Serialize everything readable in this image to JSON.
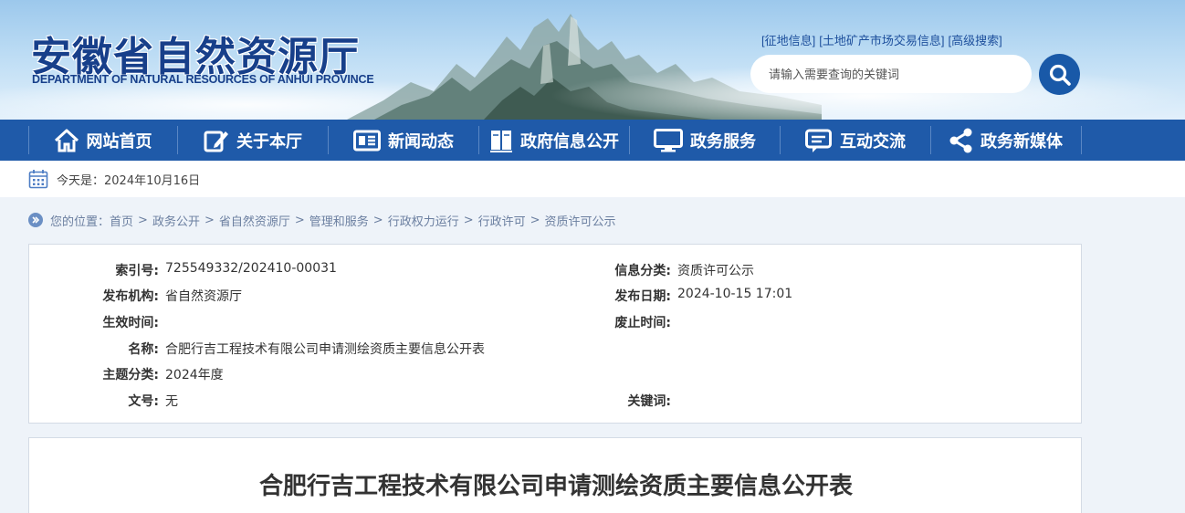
{
  "header": {
    "logo_cn": "安徽省自然资源厅",
    "logo_en": "DEPARTMENT OF NATURAL RESOURCES OF ANHUI PROVINCE",
    "top_links": [
      "[征地信息]",
      "[土地矿产市场交易信息]",
      "[高级搜索]"
    ],
    "search_placeholder": "请输入需要查询的关键词"
  },
  "nav": {
    "items": [
      {
        "label": "网站首页",
        "icon": "home-icon"
      },
      {
        "label": "关于本厅",
        "icon": "edit-icon"
      },
      {
        "label": "新闻动态",
        "icon": "news-icon"
      },
      {
        "label": "政府信息公开",
        "icon": "book-icon"
      },
      {
        "label": "政务服务",
        "icon": "monitor-icon"
      },
      {
        "label": "互动交流",
        "icon": "chat-icon"
      },
      {
        "label": "政务新媒体",
        "icon": "share-icon"
      }
    ]
  },
  "date_text": "今天是：2024年10月16日",
  "breadcrumb": {
    "prefix": "您的位置：",
    "items": [
      "首页",
      "政务公开",
      "省自然资源厅",
      "管理和服务",
      "行政权力运行",
      "行政许可",
      "资质许可公示"
    ]
  },
  "info": {
    "index_no_label": "索引号:",
    "index_no": "725549332/202410-00031",
    "category_label": "信息分类:",
    "category": "资质许可公示",
    "publisher_label": "发布机构:",
    "publisher": "省自然资源厅",
    "publish_date_label": "发布日期:",
    "publish_date": "2024-10-15 17:01",
    "effective_label": "生效时间:",
    "effective": "",
    "repeal_label": "废止时间:",
    "repeal": "",
    "name_label": "名称:",
    "name": "合肥行吉工程技术有限公司申请测绘资质主要信息公开表",
    "topic_label": "主题分类:",
    "topic": "2024年度",
    "doc_no_label": "文号:",
    "doc_no": "无",
    "keywords_label": "关键词:",
    "keywords": ""
  },
  "doc_title": "合肥行吉工程技术有限公司申请测绘资质主要信息公开表",
  "colors": {
    "nav_bg": "#1f5aa9",
    "logo": "#173f8a",
    "search_btn": "#1959a8"
  }
}
